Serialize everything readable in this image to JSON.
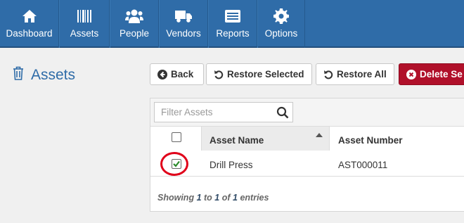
{
  "nav": {
    "items": [
      {
        "label": "Dashboard",
        "icon": "home-icon"
      },
      {
        "label": "Assets",
        "icon": "barcode-icon"
      },
      {
        "label": "People",
        "icon": "users-icon"
      },
      {
        "label": "Vendors",
        "icon": "truck-icon"
      },
      {
        "label": "Reports",
        "icon": "report-icon"
      },
      {
        "label": "Options",
        "icon": "gear-icon"
      }
    ]
  },
  "page": {
    "title": "Assets",
    "icon": "trash-icon"
  },
  "toolbar": {
    "back_label": "Back",
    "restore_selected_label": "Restore Selected",
    "restore_all_label": "Restore All",
    "delete_label": "Delete Se"
  },
  "filter": {
    "placeholder": "Filter Assets",
    "value": ""
  },
  "table": {
    "columns": [
      "Asset Name",
      "Asset Number"
    ],
    "rows": [
      {
        "name": "Drill Press",
        "number": "AST000011",
        "selected": true
      }
    ],
    "footer": {
      "prefix": "Showing",
      "from": "1",
      "to_word": "to",
      "to": "1",
      "of_word": "of",
      "total": "1",
      "suffix": "entries"
    }
  },
  "colors": {
    "nav_bg": "#2f6ca8",
    "delete_bg": "#b0102a",
    "check_green": "#2a8a2a",
    "highlight": "#e0001a"
  }
}
